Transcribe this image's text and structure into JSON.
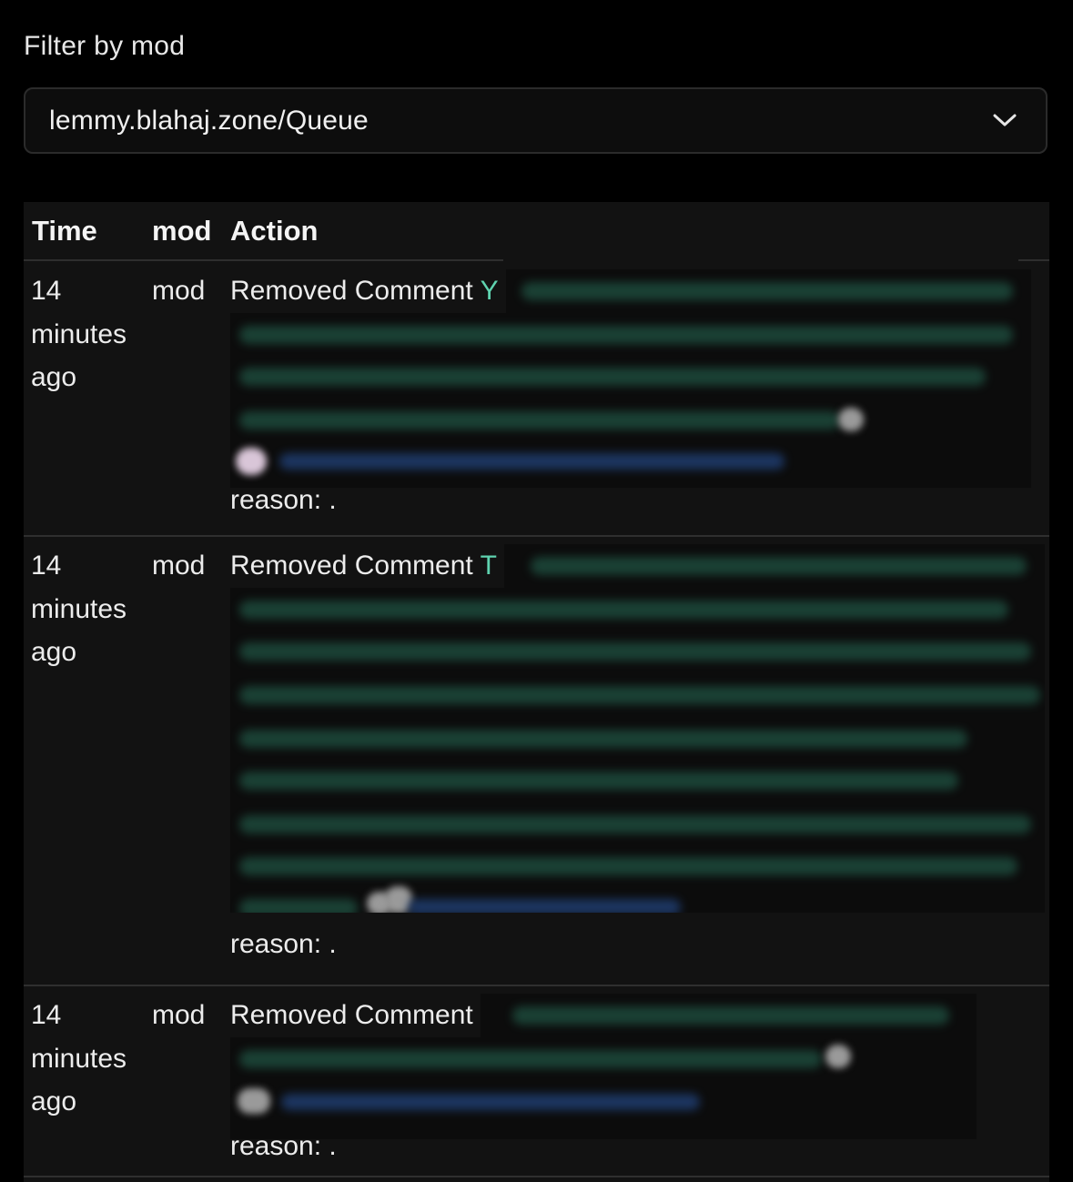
{
  "filter": {
    "label": "Filter by mod",
    "selected": "lemmy.blahaj.zone/Queue"
  },
  "table": {
    "headers": {
      "time": "Time",
      "mod": "mod",
      "action": "Action"
    },
    "rows": [
      {
        "time": "14 minutes ago",
        "time_lines": [
          "14",
          "minutes",
          "ago"
        ],
        "mod": "mod",
        "action": "Removed Comment",
        "first_visible_char": "Y",
        "reason": "reason: ."
      },
      {
        "time": "14 minutes ago",
        "time_lines": [
          "14",
          "minutes",
          "ago"
        ],
        "mod": "mod",
        "action": "Removed Comment",
        "first_visible_char": "T",
        "reason": "reason: ."
      },
      {
        "time": "14 minutes ago",
        "time_lines": [
          "14",
          "minutes",
          "ago"
        ],
        "mod": "mod",
        "action": "Removed Comment",
        "first_visible_char": "",
        "reason": "reason: ."
      }
    ]
  },
  "colors": {
    "background": "#000000",
    "table_background": "#121212",
    "accent": "#5fd3b0",
    "text": "#ececec"
  },
  "icons": {
    "dropdown": "chevron-down-icon"
  }
}
